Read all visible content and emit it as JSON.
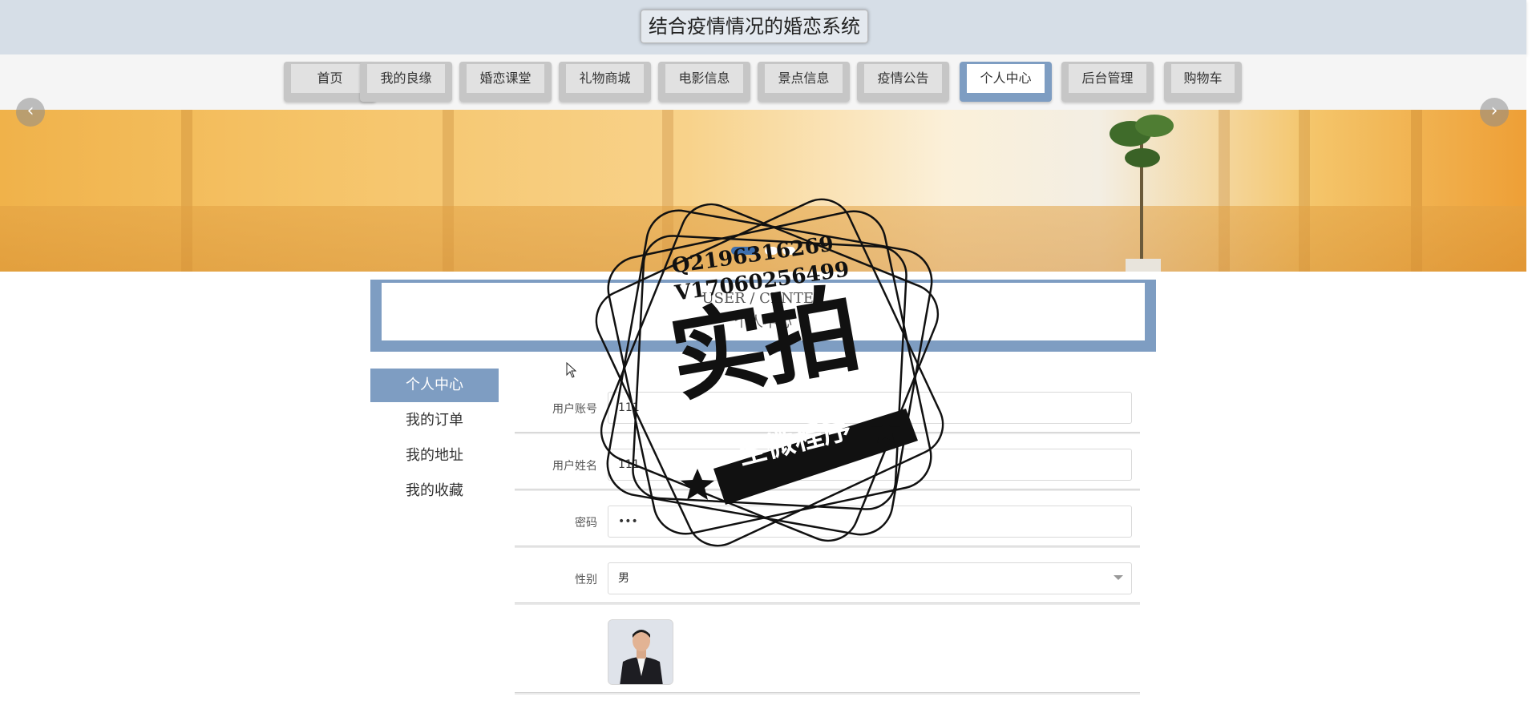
{
  "header": {
    "title": "结合疫情情况的婚恋系统"
  },
  "nav": {
    "items": [
      {
        "label": "首页",
        "active": false
      },
      {
        "label": "我的良缘",
        "active": false
      },
      {
        "label": "婚恋课堂",
        "active": false
      },
      {
        "label": "礼物商城",
        "active": false
      },
      {
        "label": "电影信息",
        "active": false
      },
      {
        "label": "景点信息",
        "active": false
      },
      {
        "label": "疫情公告",
        "active": false
      },
      {
        "label": "个人中心",
        "active": true
      },
      {
        "label": "后台管理",
        "active": false
      },
      {
        "label": "购物车",
        "active": false
      }
    ]
  },
  "banner": {
    "prev_icon": "chevron-left-icon",
    "next_icon": "chevron-right-icon",
    "slide_count": 3,
    "active_slide": 1
  },
  "section": {
    "title_en": "USER / CENTER",
    "title_cn": "个人中心"
  },
  "sidebar": {
    "items": [
      {
        "label": "个人中心",
        "active": true
      },
      {
        "label": "我的订单",
        "active": false
      },
      {
        "label": "我的地址",
        "active": false
      },
      {
        "label": "我的收藏",
        "active": false
      }
    ]
  },
  "form": {
    "account_label": "用户账号",
    "account_value": "111",
    "name_label": "用户姓名",
    "name_value": "111",
    "password_label": "密码",
    "password_value": "•••",
    "gender_label": "性别",
    "gender_value": "男"
  },
  "watermark": {
    "line1": "Q2196316269",
    "line2": "V17060256499",
    "big": "实拍",
    "band": "全微程序"
  },
  "colors": {
    "accent": "#7e9dc2",
    "header_bg": "#d6dee7",
    "nav_tab": "#c6c6c6"
  }
}
